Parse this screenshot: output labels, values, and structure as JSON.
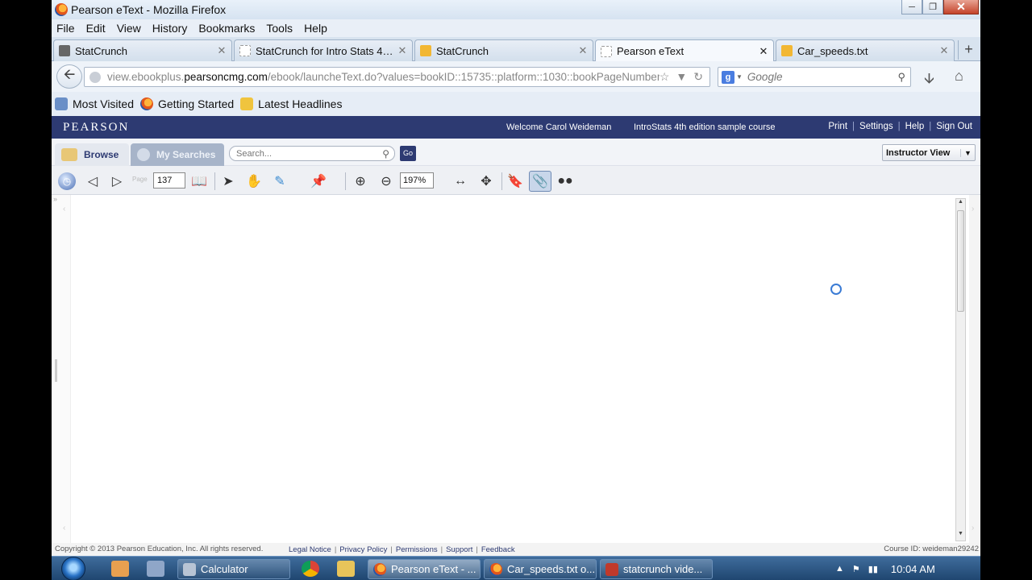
{
  "window": {
    "title": "Pearson eText - Mozilla Firefox"
  },
  "menu": [
    "File",
    "Edit",
    "View",
    "History",
    "Bookmarks",
    "Tools",
    "Help"
  ],
  "tabs": [
    {
      "label": "StatCrunch"
    },
    {
      "label": "StatCrunch for Intro Stats 4e..."
    },
    {
      "label": "StatCrunch"
    },
    {
      "label": "Pearson eText"
    },
    {
      "label": "Car_speeds.txt"
    }
  ],
  "nav": {
    "url_prefix": "view.ebookplus.",
    "url_domain": "pearsoncmg.com",
    "url_path": "/ebook/launcheText.do?values=bookID::15735::platform::1030::bookPageNumber",
    "search_placeholder": "Google"
  },
  "bookmarks": [
    "Most Visited",
    "Getting Started",
    "Latest Headlines"
  ],
  "pearson": {
    "logo": "PEARSON",
    "welcome": "Welcome Carol Weideman",
    "course": "IntroStats 4th edition sample course",
    "links": [
      "Print",
      "Settings",
      "Help",
      "Sign Out"
    ],
    "browse_tab": "Browse",
    "mysearches_tab": "My Searches",
    "search_placeholder": "Search...",
    "go": "Go",
    "view_select": "Instructor View"
  },
  "toolbar": {
    "page_label": "Page",
    "page_value": "137",
    "zoom_value": "197%"
  },
  "footer": {
    "copyright": "Copyright © 2013 Pearson Education, Inc. All rights reserved.",
    "links": [
      "Legal Notice",
      "Privacy Policy",
      "Permissions",
      "Support",
      "Feedback"
    ],
    "course_id": "Course ID: weideman29242"
  },
  "taskbar": {
    "buttons": [
      "Calculator",
      "Pearson eText - ...",
      "Car_speeds.txt o...",
      "statcrunch vide..."
    ],
    "clock": "10:04 AM"
  },
  "colors": {
    "pearson_blue": "#2d3a72",
    "taskbar_blue": "#1f4670"
  }
}
